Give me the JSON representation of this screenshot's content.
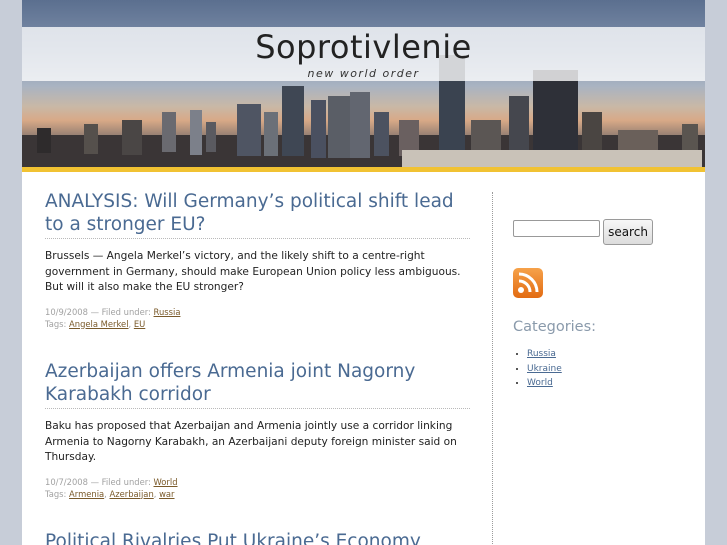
{
  "header": {
    "title": "Soprotivlenie",
    "tagline": "new world order"
  },
  "posts": [
    {
      "title": "ANALYSIS: Will Germany’s political shift lead to a stronger EU?",
      "excerpt": "Brussels — Angela Merkel’s victory, and the likely shift to a centre-right government in Germany, should make European Union policy less ambiguous. But will it also make the EU stronger?",
      "date_filed": "10/9/2008 — Filed under:",
      "category": "Russia",
      "tags_label": "Tags:",
      "tags": [
        "Angela Merkel",
        "EU"
      ]
    },
    {
      "title": "Azerbaijan offers Armenia joint Nagorny Karabakh corridor",
      "excerpt": "Baku has proposed that Azerbaijan and Armenia jointly use a corridor linking Armenia to Nagorny Karabakh, an Azerbaijani deputy foreign minister said on Thursday.",
      "date_filed": "10/7/2008 — Filed under:",
      "category": "World",
      "tags_label": "Tags:",
      "tags": [
        "Armenia",
        "Azerbaijan",
        "war"
      ]
    },
    {
      "title": "Political Rivalries Put Ukraine’s Economy"
    }
  ],
  "sidebar": {
    "search_placeholder": "",
    "search_button": "search",
    "rss_icon": "rss-feed-icon",
    "categories_title": "Categories:",
    "categories": [
      "Russia",
      "Ukraine",
      "World"
    ]
  },
  "colors": {
    "link": "#4a6a92",
    "header_bar": "#f1c232",
    "page_bg": "#c7cdd8"
  }
}
